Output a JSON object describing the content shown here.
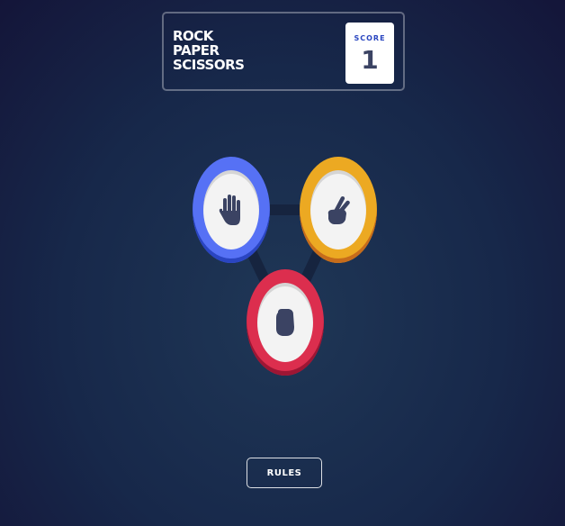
{
  "header": {
    "title_lines": [
      "ROCK",
      "PAPER",
      "SCISSORS"
    ],
    "score_label": "SCORE",
    "score_value": "1"
  },
  "choices": [
    {
      "name": "paper",
      "icon": "paper-hand-icon",
      "color": "#5671f5"
    },
    {
      "name": "scissors",
      "icon": "scissors-hand-icon",
      "color": "#eca922"
    },
    {
      "name": "rock",
      "icon": "rock-hand-icon",
      "color": "#dc2e4e"
    }
  ],
  "footer": {
    "rules_label": "RULES"
  },
  "colors": {
    "background": "#1f3756",
    "score_label": "#2a46c0",
    "score_value": "#3b4363",
    "icon": "#3b4363"
  }
}
